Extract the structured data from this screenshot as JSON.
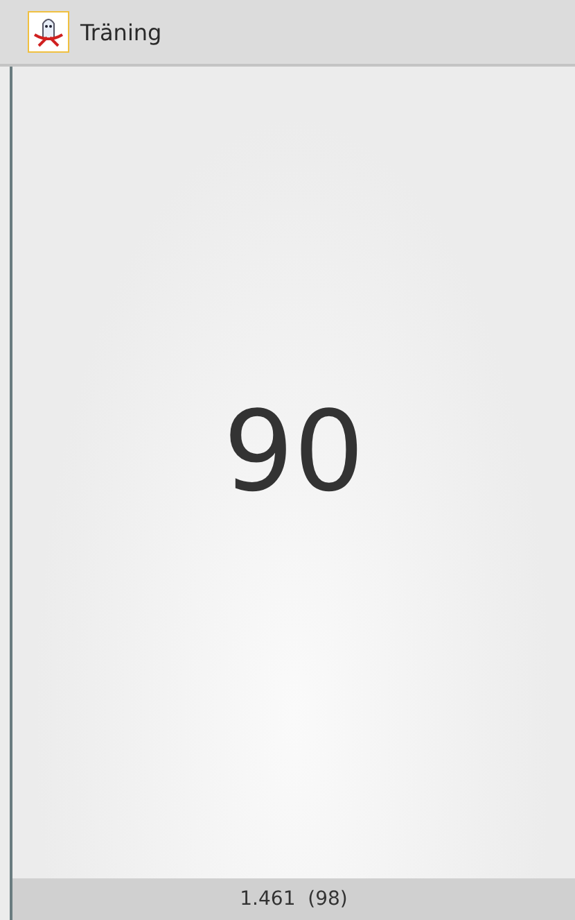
{
  "app_bar": {
    "title": "Träning"
  },
  "counter": {
    "value": "90"
  },
  "status_bar": {
    "text": "1.461  (98)"
  }
}
